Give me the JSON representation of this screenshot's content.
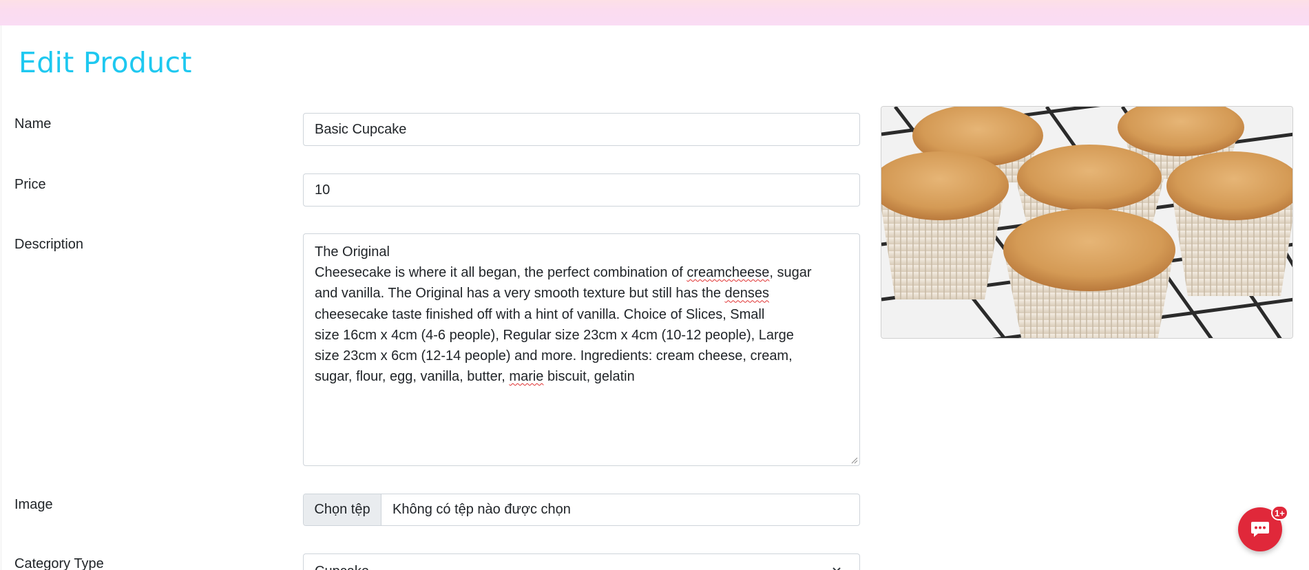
{
  "page": {
    "title": "Edit Product"
  },
  "form": {
    "name": {
      "label": "Name",
      "value": "Basic Cupcake"
    },
    "price": {
      "label": "Price",
      "value": "10"
    },
    "description": {
      "label": "Description",
      "lines": [
        [
          "The Original"
        ],
        [
          "Cheesecake is where it all began, the perfect combination of ",
          "creamcheese",
          ", sugar"
        ],
        [
          "and vanilla. The Original has a very smooth texture but still has the ",
          "denses"
        ],
        [
          "cheesecake taste finished off with a hint of vanilla. Choice of Slices, Small"
        ],
        [
          "size 16cm x 4cm (4-6 people), Regular size 23cm x 4cm (10-12 people), Large"
        ],
        [
          "size 23cm x 6cm (12-14 people) and more. Ingredients: cream cheese, cream,"
        ],
        [
          "sugar, flour, egg, vanilla, butter, ",
          "marie",
          " biscuit, gelatin"
        ]
      ]
    },
    "image": {
      "label": "Image",
      "button_label": "Chọn tệp",
      "file_status": "Không có tệp nào được chọn"
    },
    "category_type": {
      "label": "Category Type",
      "selected": "Cupcake"
    }
  },
  "product_image": {
    "icon": "cupcakes-photo"
  },
  "chat": {
    "badge": "1+",
    "icon": "chat-bubble-icon"
  },
  "colors": {
    "title": "#1ec8f0",
    "chat_button": "#e0283a",
    "top_strip": "#fadcf4"
  }
}
